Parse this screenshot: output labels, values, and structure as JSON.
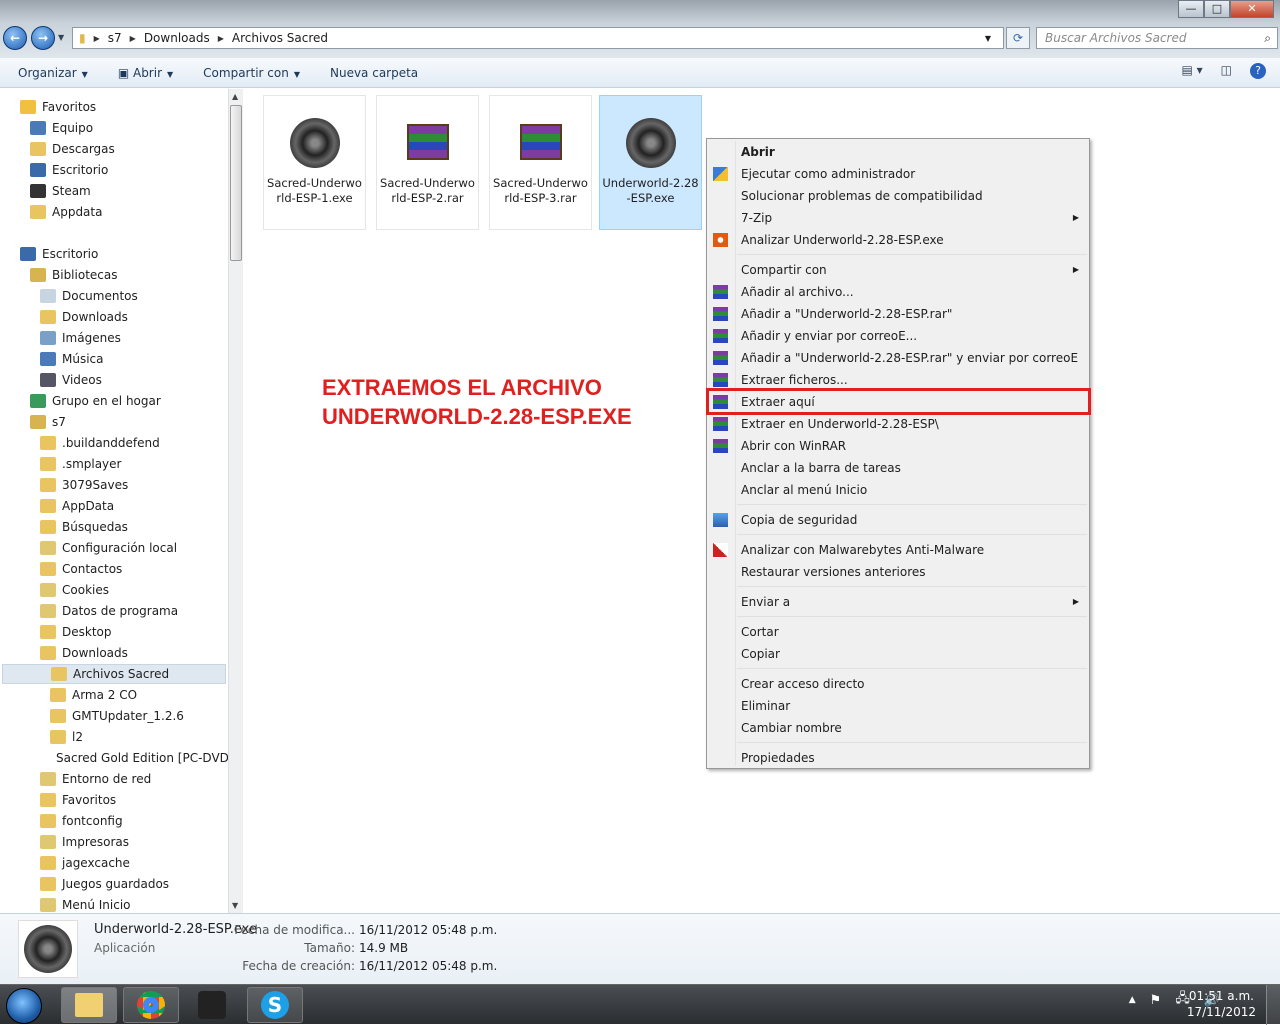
{
  "window": {
    "minimize": "—",
    "maximize": "□",
    "close": "✕"
  },
  "address": {
    "path": [
      "s7",
      "Downloads",
      "Archivos Sacred"
    ],
    "search_placeholder": "Buscar Archivos Sacred"
  },
  "toolbar": {
    "organize": "Organizar",
    "open": "Abrir",
    "share": "Compartir con",
    "new_folder": "Nueva carpeta"
  },
  "sidebar": [
    {
      "label": "Favoritos",
      "level": 0,
      "icon": "star-icon"
    },
    {
      "label": "Equipo",
      "level": 1,
      "icon": "computer-icon"
    },
    {
      "label": "Descargas",
      "level": 1,
      "icon": "folder-icon"
    },
    {
      "label": "Escritorio",
      "level": 1,
      "icon": "desktop-icon"
    },
    {
      "label": "Steam",
      "level": 1,
      "icon": "steam-icon"
    },
    {
      "label": "Appdata",
      "level": 1,
      "icon": "folder-icon"
    },
    {
      "label": "",
      "level": -1
    },
    {
      "label": "Escritorio",
      "level": 0,
      "icon": "desktop-icon"
    },
    {
      "label": "Bibliotecas",
      "level": 1,
      "icon": "library-icon"
    },
    {
      "label": "Documentos",
      "level": 2,
      "icon": "documents-icon"
    },
    {
      "label": "Downloads",
      "level": 2,
      "icon": "folder-icon"
    },
    {
      "label": "Imágenes",
      "level": 2,
      "icon": "pictures-icon"
    },
    {
      "label": "Música",
      "level": 2,
      "icon": "music-icon"
    },
    {
      "label": "Videos",
      "level": 2,
      "icon": "videos-icon"
    },
    {
      "label": "Grupo en el hogar",
      "level": 1,
      "icon": "homegroup-icon"
    },
    {
      "label": "s7",
      "level": 1,
      "icon": "user-folder-icon"
    },
    {
      "label": ".buildanddefend",
      "level": 2,
      "icon": "folder-icon"
    },
    {
      "label": ".smplayer",
      "level": 2,
      "icon": "folder-icon"
    },
    {
      "label": "3079Saves",
      "level": 2,
      "icon": "folder-icon"
    },
    {
      "label": "AppData",
      "level": 2,
      "icon": "folder-icon"
    },
    {
      "label": "Búsquedas",
      "level": 2,
      "icon": "folder-icon"
    },
    {
      "label": "Configuración local",
      "level": 2,
      "icon": "shortcut-folder-icon"
    },
    {
      "label": "Contactos",
      "level": 2,
      "icon": "folder-icon"
    },
    {
      "label": "Cookies",
      "level": 2,
      "icon": "shortcut-folder-icon"
    },
    {
      "label": "Datos de programa",
      "level": 2,
      "icon": "shortcut-folder-icon"
    },
    {
      "label": "Desktop",
      "level": 2,
      "icon": "folder-icon"
    },
    {
      "label": "Downloads",
      "level": 2,
      "icon": "folder-icon"
    },
    {
      "label": "Archivos Sacred",
      "level": 3,
      "icon": "folder-icon",
      "selected": true
    },
    {
      "label": "Arma 2 CO",
      "level": 3,
      "icon": "folder-icon"
    },
    {
      "label": "GMTUpdater_1.2.6",
      "level": 3,
      "icon": "folder-icon"
    },
    {
      "label": "l2",
      "level": 3,
      "icon": "folder-icon"
    },
    {
      "label": "Sacred Gold Edition [PC-DVD",
      "level": 3,
      "icon": "folder-icon"
    },
    {
      "label": "Entorno de red",
      "level": 2,
      "icon": "shortcut-folder-icon"
    },
    {
      "label": "Favoritos",
      "level": 2,
      "icon": "folder-icon"
    },
    {
      "label": "fontconfig",
      "level": 2,
      "icon": "folder-icon"
    },
    {
      "label": "Impresoras",
      "level": 2,
      "icon": "shortcut-folder-icon"
    },
    {
      "label": "jagexcache",
      "level": 2,
      "icon": "folder-icon"
    },
    {
      "label": "Juegos guardados",
      "level": 2,
      "icon": "folder-icon"
    },
    {
      "label": "Menú Inicio",
      "level": 2,
      "icon": "shortcut-folder-icon"
    }
  ],
  "files": [
    {
      "name": "Sacred-Underworld-ESP-1.exe",
      "type": "exe"
    },
    {
      "name": "Sacred-Underworld-ESP-2.rar",
      "type": "rar"
    },
    {
      "name": "Sacred-Underworld-ESP-3.rar",
      "type": "rar"
    },
    {
      "name": "Underworld-2.28-ESP.exe",
      "type": "exe",
      "selected": true
    }
  ],
  "annotation": {
    "line1": "EXTRAEMOS EL ARCHIVO",
    "line2": "UNDERWORLD-2.28-ESP.EXE"
  },
  "context_menu": [
    {
      "label": "Abrir",
      "bold": true
    },
    {
      "label": "Ejecutar como administrador",
      "icon": "shield-icon"
    },
    {
      "label": "Solucionar problemas de compatibilidad"
    },
    {
      "label": "7-Zip",
      "submenu": true
    },
    {
      "label": "Analizar Underworld-2.28-ESP.exe",
      "icon": "antivirus-icon"
    },
    {
      "sep": true
    },
    {
      "label": "Compartir con",
      "submenu": true
    },
    {
      "label": "Añadir al archivo...",
      "icon": "winrar-icon"
    },
    {
      "label": "Añadir a \"Underworld-2.28-ESP.rar\"",
      "icon": "winrar-icon"
    },
    {
      "label": "Añadir y enviar por correoE...",
      "icon": "winrar-icon"
    },
    {
      "label": "Añadir a \"Underworld-2.28-ESP.rar\" y enviar por correoE",
      "icon": "winrar-icon"
    },
    {
      "label": "Extraer ficheros...",
      "icon": "winrar-icon"
    },
    {
      "label": "Extraer aquí",
      "icon": "winrar-icon",
      "highlighted": true
    },
    {
      "label": "Extraer en Underworld-2.28-ESP\\",
      "icon": "winrar-icon"
    },
    {
      "label": "Abrir con WinRAR",
      "icon": "winrar-icon"
    },
    {
      "label": "Anclar a la barra de tareas"
    },
    {
      "label": "Anclar al menú Inicio"
    },
    {
      "sep": true
    },
    {
      "label": "Copia de seguridad",
      "icon": "backup-icon"
    },
    {
      "sep": true
    },
    {
      "label": "Analizar con Malwarebytes Anti-Malware",
      "icon": "malwarebytes-icon"
    },
    {
      "label": "Restaurar versiones anteriores"
    },
    {
      "sep": true
    },
    {
      "label": "Enviar a",
      "submenu": true
    },
    {
      "sep": true
    },
    {
      "label": "Cortar"
    },
    {
      "label": "Copiar"
    },
    {
      "sep": true
    },
    {
      "label": "Crear acceso directo"
    },
    {
      "label": "Eliminar"
    },
    {
      "label": "Cambiar nombre"
    },
    {
      "sep": true
    },
    {
      "label": "Propiedades"
    }
  ],
  "details": {
    "name": "Underworld-2.28-ESP.exe",
    "type": "Aplicación",
    "modified_label": "Fecha de modifica...",
    "modified": "16/11/2012 05:48 p.m.",
    "size_label": "Tamaño:",
    "size": "14.9 MB",
    "created_label": "Fecha de creación:",
    "created": "16/11/2012 05:48 p.m."
  },
  "taskbar": {
    "time": "01:51 a.m.",
    "date": "17/11/2012"
  },
  "colors": {
    "annotation": "#e0201f",
    "selection": "#cce8ff"
  }
}
